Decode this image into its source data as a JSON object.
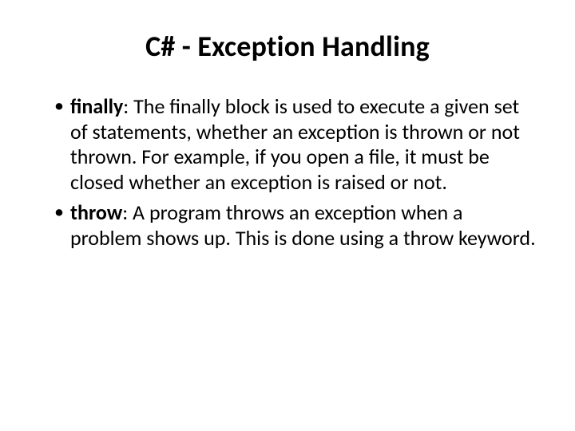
{
  "title": "C# - Exception Handling",
  "bullets": [
    {
      "keyword": "finally",
      "text": ": The finally block is used to execute a given set of statements, whether an exception is thrown or not thrown. For example, if you open a file, it must be closed whether an exception is raised or not."
    },
    {
      "keyword": "throw",
      "text": ": A program throws an exception when a problem shows up. This is done using a throw keyword."
    }
  ]
}
